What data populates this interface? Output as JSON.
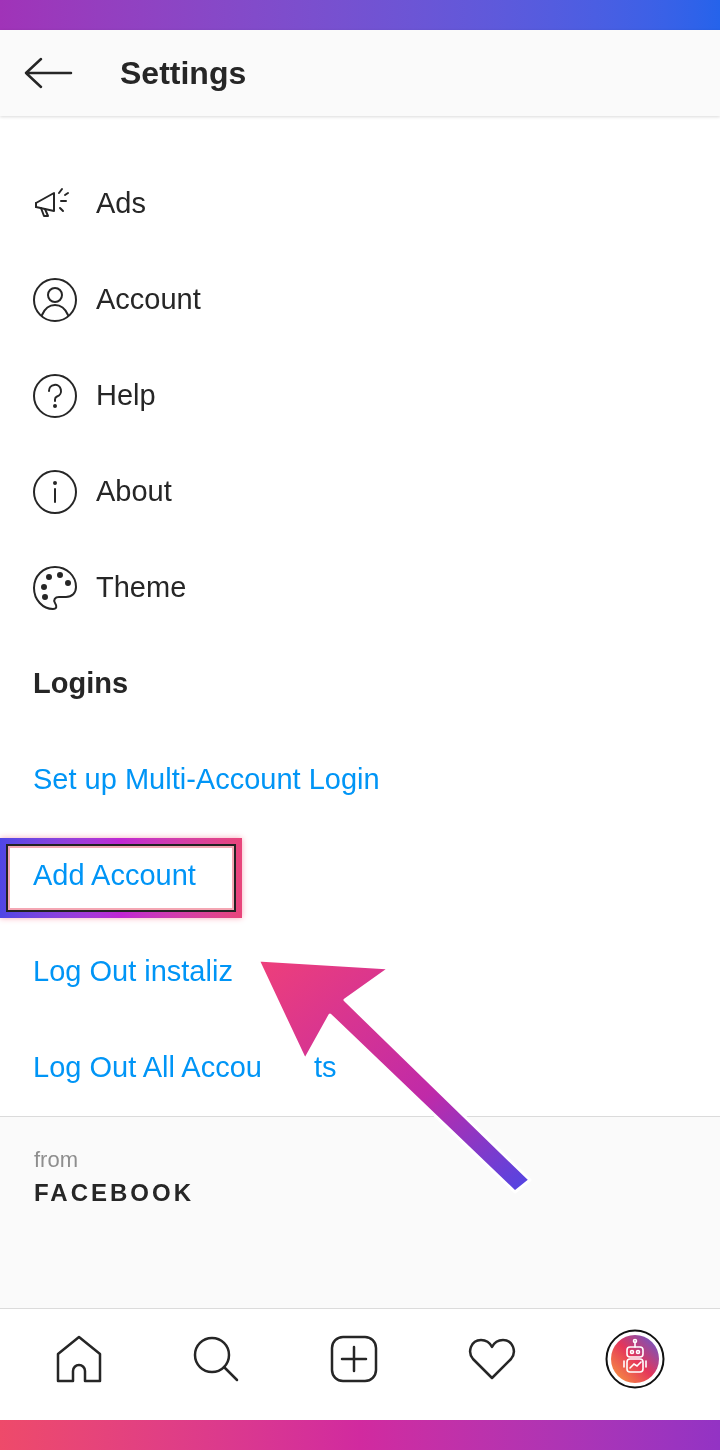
{
  "header": {
    "title": "Settings"
  },
  "menu_items": [
    {
      "kind": "ads",
      "label": "Ads"
    },
    {
      "kind": "account",
      "label": "Account"
    },
    {
      "kind": "help",
      "label": "Help"
    },
    {
      "kind": "about",
      "label": "About"
    },
    {
      "kind": "theme",
      "label": "Theme"
    }
  ],
  "logins": {
    "heading": "Logins",
    "links": [
      {
        "label": "Set up Multi-Account Login",
        "highlighted": false
      },
      {
        "label": "Add Account",
        "highlighted": true
      },
      {
        "label": "Log Out instaliz",
        "highlighted": false
      },
      {
        "label": "Log Out All Accou",
        "tail": "ts",
        "highlighted": false
      }
    ]
  },
  "footer": {
    "from": "from",
    "brand": "FACEBOOK"
  },
  "bottom_nav": [
    {
      "kind": "home"
    },
    {
      "kind": "search"
    },
    {
      "kind": "add"
    },
    {
      "kind": "heart"
    },
    {
      "kind": "profile"
    }
  ]
}
